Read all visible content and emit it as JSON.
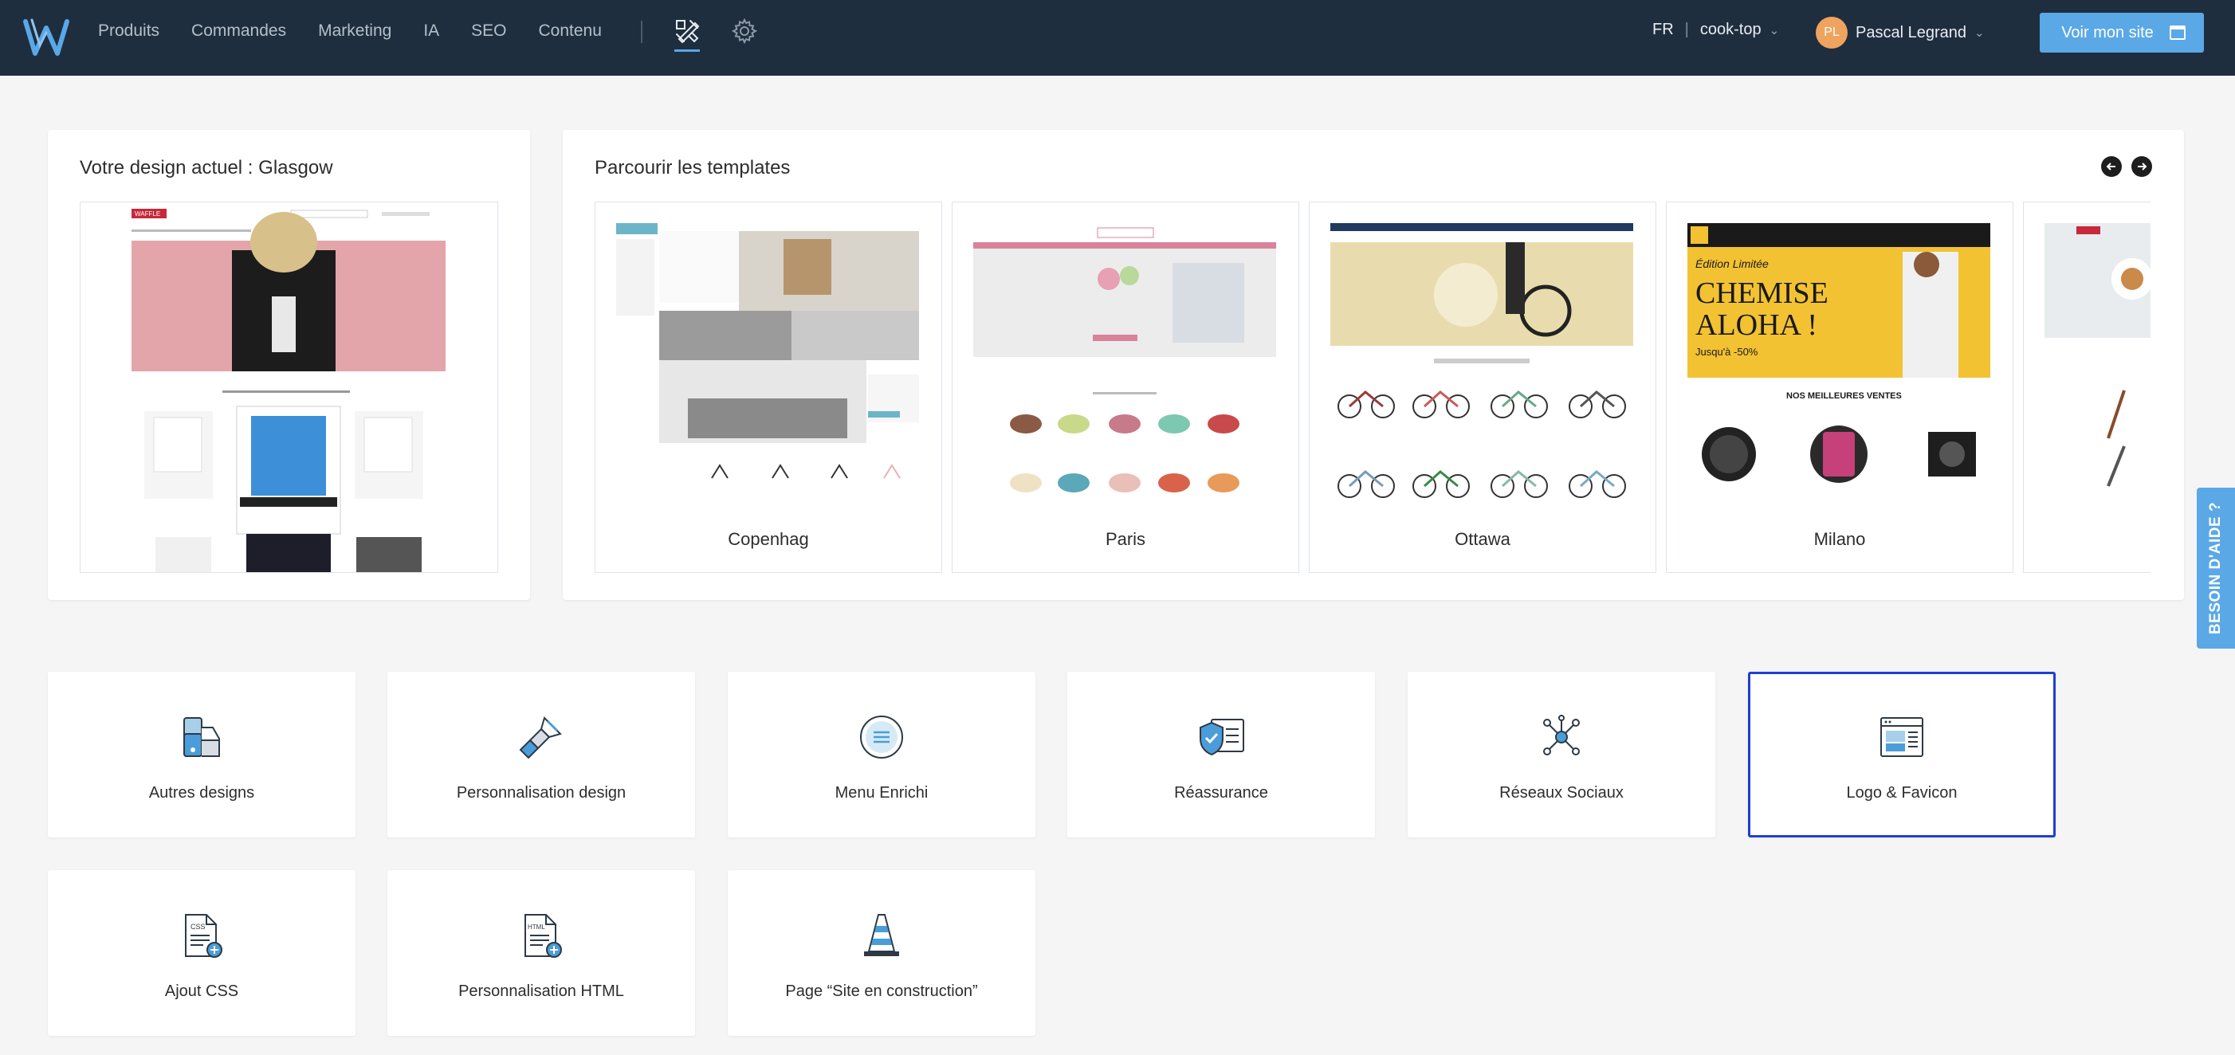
{
  "nav": {
    "items": [
      "Produits",
      "Commandes",
      "Marketing",
      "IA",
      "SEO",
      "Contenu"
    ],
    "lang": "FR",
    "shop": "cook-top",
    "user_initials": "PL",
    "user_name": "Pascal Legrand",
    "visit_label": "Voir mon site"
  },
  "current_design": {
    "title": "Votre design actuel : Glasgow",
    "preview_brand": "WAFFLE"
  },
  "templates": {
    "title": "Parcourir les templates",
    "items": [
      {
        "name": "Copenhag"
      },
      {
        "name": "Paris"
      },
      {
        "name": "Ottawa"
      },
      {
        "name": "Milano",
        "banner_line1": "Édition Limitée",
        "banner_line2": "CHEMISE",
        "banner_line3": "ALOHA !",
        "banner_line4": "Jusqu'à -50%",
        "section": "NOS MEILLEURES VENTES"
      }
    ]
  },
  "tiles": [
    {
      "label": "Autres designs",
      "icon": "palette-swatch-icon"
    },
    {
      "label": "Personnalisation design",
      "icon": "paint-brush-icon"
    },
    {
      "label": "Menu Enrichi",
      "icon": "menu-circle-icon"
    },
    {
      "label": "Réassurance",
      "icon": "shield-check-icon"
    },
    {
      "label": "Réseaux Sociaux",
      "icon": "network-icon"
    },
    {
      "label": "Logo & Favicon",
      "icon": "browser-window-icon",
      "selected": true
    },
    {
      "label": "Ajout CSS",
      "icon": "css-file-icon"
    },
    {
      "label": "Personnalisation HTML",
      "icon": "html-file-icon"
    },
    {
      "label": "Page “Site en construction”",
      "icon": "traffic-cone-icon"
    }
  ],
  "help_label": "BESOIN D'AIDE ?",
  "colors": {
    "topbar": "#1f2e3f",
    "accent": "#5aa8e6",
    "selected_border": "#1f3ed6"
  }
}
